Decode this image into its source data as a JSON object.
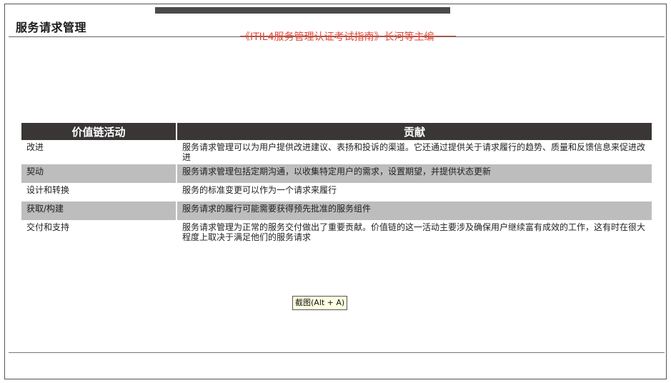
{
  "page": {
    "title": "服务请求管理",
    "source_caption": "《ITIL4服务管理认证考试指南》长河等主编"
  },
  "table": {
    "headers": [
      "价值链活动",
      "贡献"
    ],
    "rows": [
      {
        "activity": "改进",
        "contribution": "服务请求管理可以为用户提供改进建议、表扬和投诉的渠道。它还通过提供关于请求履行的趋势、质量和反馈信息来促进改进"
      },
      {
        "activity": "契动",
        "contribution": "服务请求管理包括定期沟通，以收集特定用户的需求，设置期望，并提供状态更新"
      },
      {
        "activity": "设计和转换",
        "contribution": "服务的标准变更可以作为一个请求来履行"
      },
      {
        "activity": "获取/构建",
        "contribution": "服务请求的履行可能需要获得预先批准的服务组件"
      },
      {
        "activity": "交付和支持",
        "contribution": "服务请求管理为正常的服务交付做出了重要贡献。价值链的这一活动主要涉及确保用户继续富有成效的工作，这有时在很大程度上取决于满足他们的服务请求"
      }
    ],
    "colors": {
      "header_bg": "#3a3636",
      "shade_bg": "#bdbdbd"
    }
  },
  "tooltip": {
    "label": "截图(Alt + A)"
  },
  "colors": {
    "caption": "#e0483a"
  }
}
